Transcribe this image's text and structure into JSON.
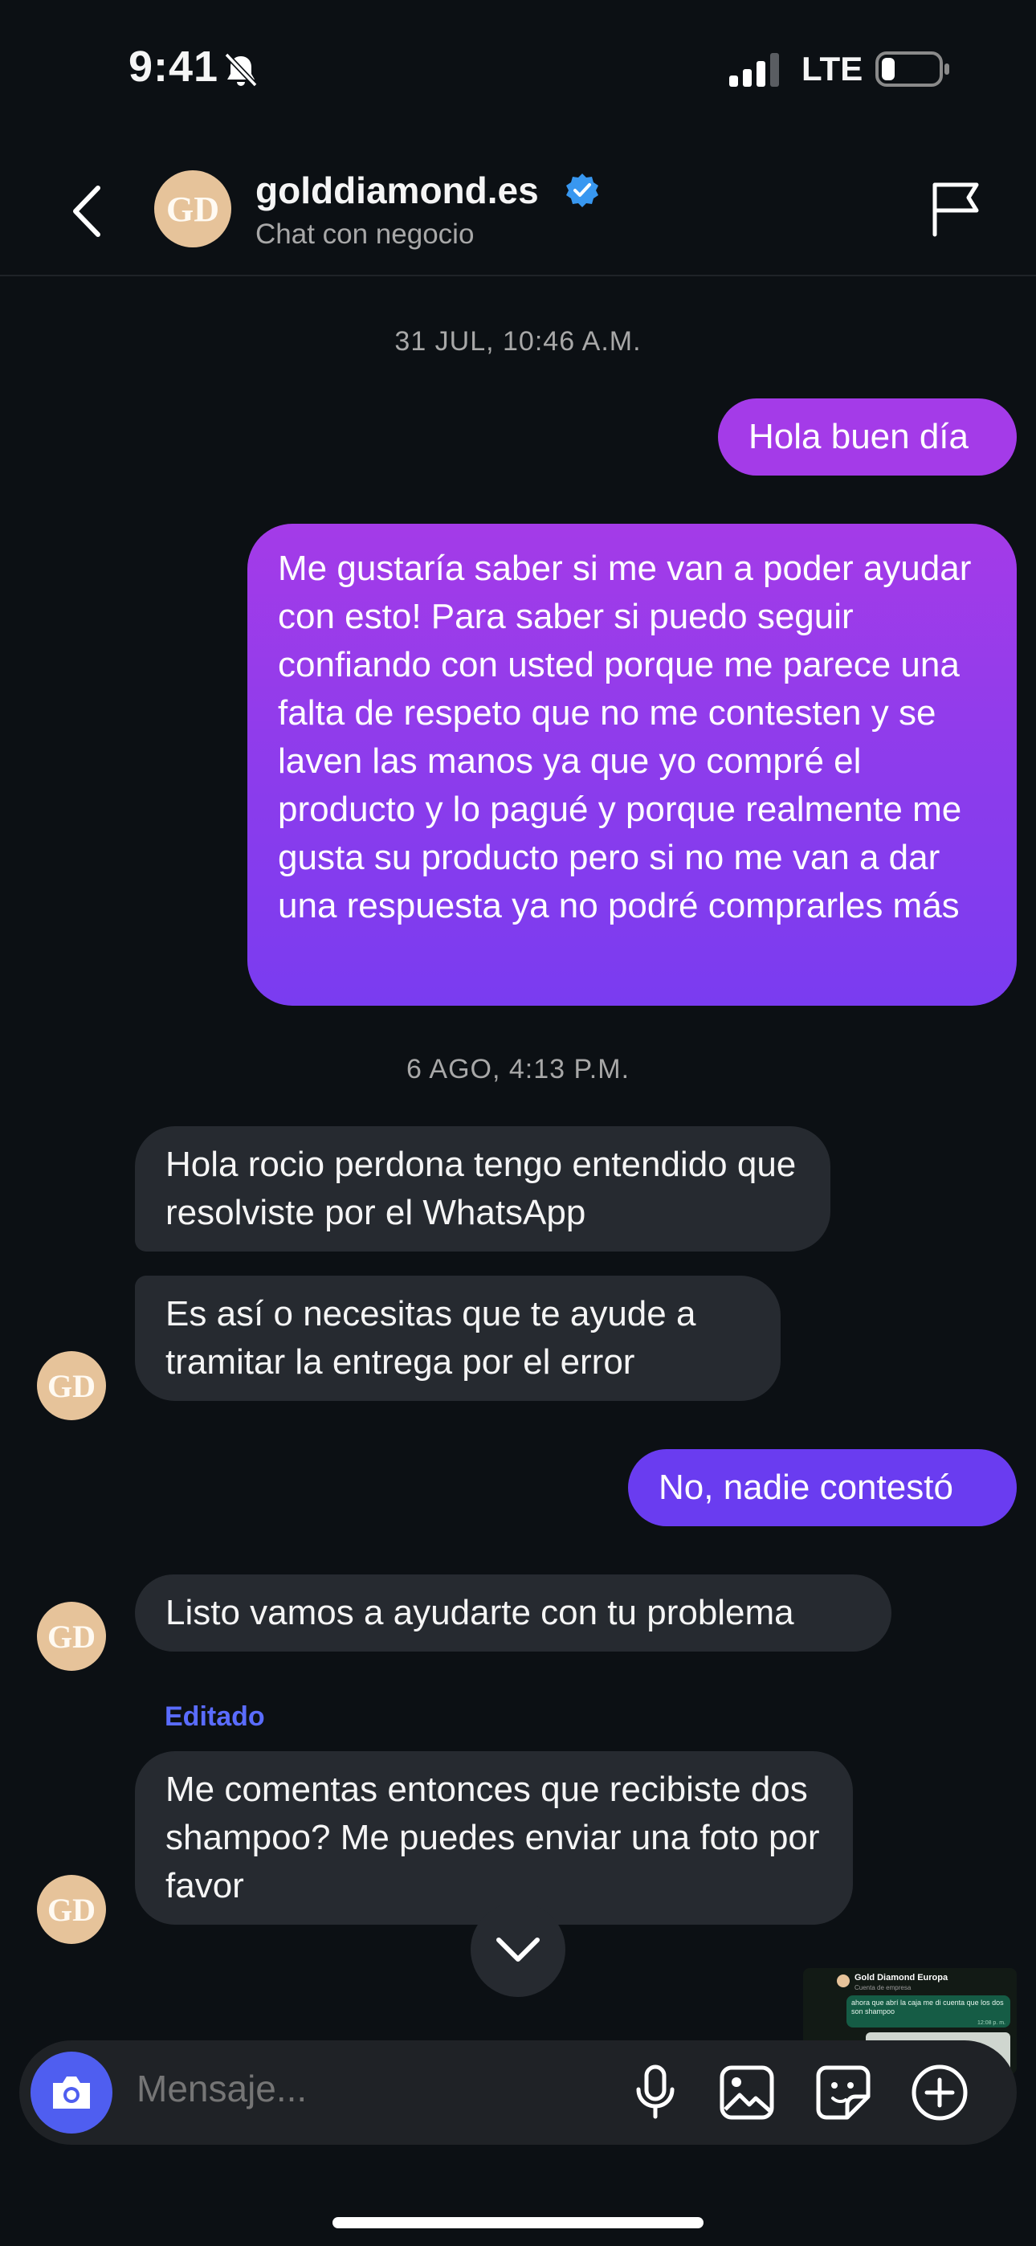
{
  "status_bar": {
    "time": "9:41",
    "network": "LTE"
  },
  "header": {
    "username": "golddiamond.es",
    "subtitle": "Chat con negocio",
    "avatar_initials": "GD"
  },
  "messages": [
    {
      "type": "timestamp",
      "text": "31 JUL, 10:46 A.M."
    },
    {
      "type": "outgoing",
      "text": "Hola buen día"
    },
    {
      "type": "outgoing",
      "text": "Me gustaría saber si me van a poder ayudar con esto! Para saber si puedo seguir confiando con usted porque me parece una falta de respeto que no me contesten y se laven las manos ya que yo compré el producto y lo pagué y porque realmente me gusta su producto pero si no me van a dar una respuesta ya no podré comprarles más"
    },
    {
      "type": "timestamp",
      "text": "6 AGO, 4:13 P.M."
    },
    {
      "type": "incoming",
      "text": "Hola rocio perdona tengo entendido que resolviste por el WhatsApp"
    },
    {
      "type": "incoming",
      "text": "Es así o necesitas que te ayude a tramitar la entrega por el error"
    },
    {
      "type": "outgoing",
      "text": "No, nadie contestó"
    },
    {
      "type": "incoming",
      "text": "Listo vamos a ayudarte con tu problema"
    },
    {
      "type": "incoming",
      "text": "Me comentas entonces que recibiste dos shampoo? Me puedes enviar una foto por favor",
      "edited_label": "Editado"
    }
  ],
  "thumbnail": {
    "title": "Gold Diamond Europa",
    "subtitle": "Cuenta de empresa",
    "message": "ahora que abrí la caja me di cuenta que los dos son shampoo",
    "time": "12:08 p. m."
  },
  "composer": {
    "placeholder": "Mensaje..."
  },
  "colors": {
    "background": "#0c1014",
    "incoming_bubble": "#262a30",
    "outgoing_top": "#a43be8",
    "outgoing_bottom": "#6a3cf0",
    "accent": "#4f5ef0",
    "verified": "#3897f0"
  },
  "icons": [
    "back-chevron-icon",
    "verified-badge-icon",
    "flag-icon",
    "bell-slash-icon",
    "signal-icon",
    "battery-icon",
    "chevron-down-icon",
    "camera-icon",
    "microphone-icon",
    "gallery-icon",
    "sticker-icon",
    "plus-circle-icon"
  ]
}
